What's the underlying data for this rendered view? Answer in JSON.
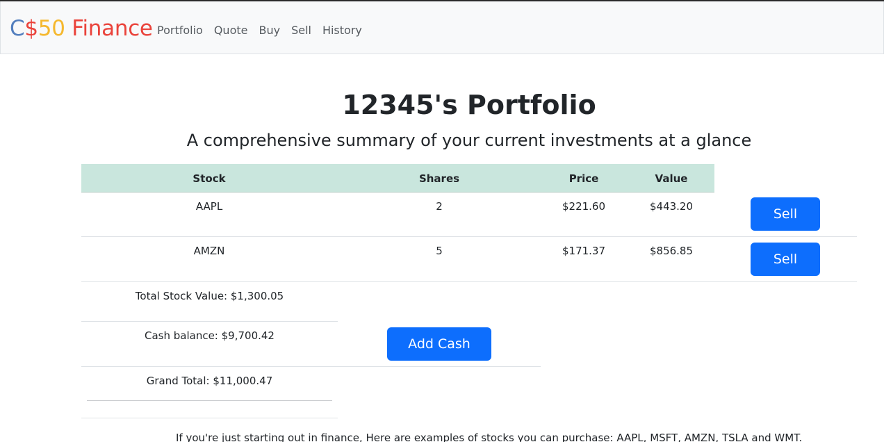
{
  "navbar": {
    "brand": {
      "parts": [
        "C",
        "$",
        "50",
        " Finance"
      ],
      "colors": [
        "#537fbe",
        "#ea433b",
        "#f5b82e",
        "#ea433b"
      ]
    },
    "links": [
      "Portfolio",
      "Quote",
      "Buy",
      "Sell",
      "History"
    ]
  },
  "page": {
    "title": "12345's Portfolio",
    "subtitle": "A comprehensive summary of your current investments at a glance"
  },
  "table": {
    "headers": [
      "Stock",
      "Shares",
      "Price",
      "Value"
    ],
    "rows": [
      {
        "stock": "AAPL",
        "shares": "2",
        "price": "$221.60",
        "value": "$443.20",
        "action": "Sell"
      },
      {
        "stock": "AMZN",
        "shares": "5",
        "price": "$171.37",
        "value": "$856.85",
        "action": "Sell"
      }
    ]
  },
  "summary": {
    "total_stock_value": "Total Stock Value: $1,300.05",
    "cash_balance": "Cash balance: $9,700.42",
    "grand_total": "Grand Total: $11,000.47",
    "add_cash_label": "Add Cash"
  },
  "footer": {
    "hint": "If you're just starting out in finance, Here are examples of stocks you can purchase: AAPL, MSFT, AMZN, TSLA and WMT."
  },
  "colors": {
    "accent": "#0d6efd",
    "header_bg": "#c9e6dd",
    "navbar_bg": "#f8f9fa"
  }
}
